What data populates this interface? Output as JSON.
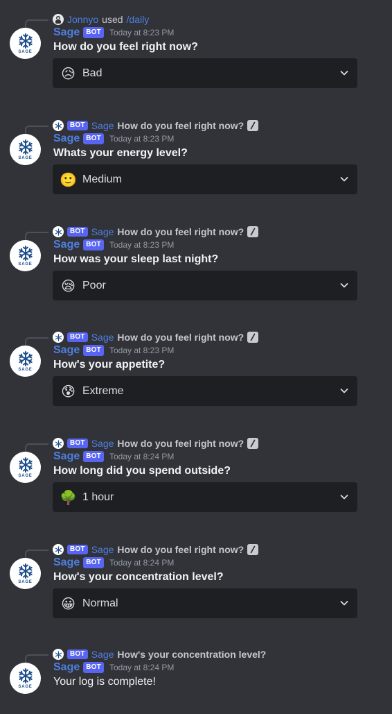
{
  "invocation": {
    "user": "Jonnyo",
    "used_text": "used",
    "command": "/daily"
  },
  "bot": {
    "name": "Sage",
    "tag": "BOT",
    "avatar_text": "SAGE"
  },
  "messages": [
    {
      "reply_text": "",
      "timestamp": "Today at 8:23 PM",
      "question": "How do you feel right now?",
      "selected_emoji": "😥",
      "selected_value": "Bad"
    },
    {
      "reply_text": "How do you feel right now?",
      "timestamp": "Today at 8:23 PM",
      "question": "Whats your energy level?",
      "selected_emoji": "🙂",
      "selected_value": "Medium"
    },
    {
      "reply_text": "How do you feel right now?",
      "timestamp": "Today at 8:23 PM",
      "question": "How was your sleep last night?",
      "selected_emoji": "😪",
      "selected_value": "Poor"
    },
    {
      "reply_text": "How do you feel right now?",
      "timestamp": "Today at 8:23 PM",
      "question": "How's your appetite?",
      "selected_emoji": "😰",
      "selected_value": "Extreme"
    },
    {
      "reply_text": "How do you feel right now?",
      "timestamp": "Today at 8:24 PM",
      "question": "How long did you spend outside?",
      "selected_emoji": "🌳",
      "selected_value": "1 hour"
    },
    {
      "reply_text": "How do you feel right now?",
      "timestamp": "Today at 8:24 PM",
      "question": "How's your concentration level?",
      "selected_emoji": "😀",
      "selected_value": "Normal"
    }
  ],
  "final": {
    "reply_text": "How's your concentration level?",
    "timestamp": "Today at 8:24 PM",
    "text": "Your log is complete!"
  },
  "colors": {
    "background": "#313338",
    "select_background": "#1e1f22",
    "author": "#4f7fe0",
    "bot_tag": "#5865f2",
    "timestamp": "#949ba4"
  },
  "icons": {
    "avatar": "snowflake-icon",
    "dropdown": "chevron-down-icon",
    "command": "slash-command-icon"
  }
}
